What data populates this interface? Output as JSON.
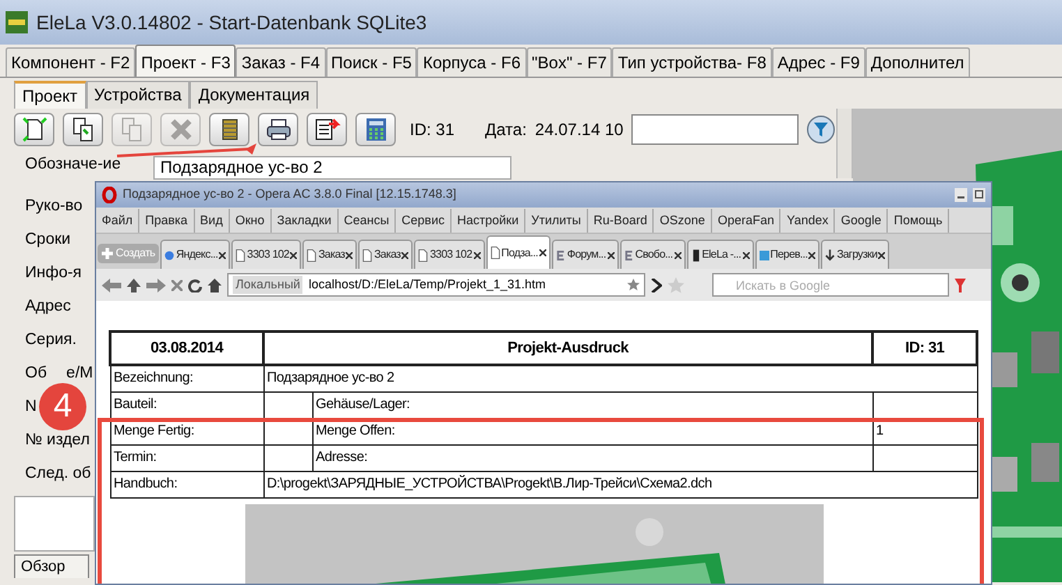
{
  "window": {
    "title": "EleLa V3.0.14802  - Start-Datenbank SQLite3"
  },
  "main_tabs": [
    {
      "label": "Компонент - F2",
      "selected": false
    },
    {
      "label": "Проект - F3",
      "selected": true
    },
    {
      "label": "Заказ - F4",
      "selected": false
    },
    {
      "label": "Поиск - F5",
      "selected": false
    },
    {
      "label": "Корпуса - F6",
      "selected": false
    },
    {
      "label": "\"Box\" - F7",
      "selected": false
    },
    {
      "label": "Тип устройства- F8",
      "selected": false
    },
    {
      "label": "Адрес - F9",
      "selected": false
    },
    {
      "label": "Дополнител",
      "selected": false
    }
  ],
  "sub_tabs": [
    {
      "label": "Проект",
      "selected": true
    },
    {
      "label": "Устройства",
      "selected": false
    },
    {
      "label": "Документация",
      "selected": false
    }
  ],
  "toolbar": {
    "buttons": [
      {
        "kind": "new",
        "disabled": false
      },
      {
        "kind": "copy",
        "disabled": false
      },
      {
        "kind": "duplicate",
        "disabled": true
      },
      {
        "kind": "delete",
        "disabled": true
      },
      {
        "kind": "spool",
        "disabled": false
      },
      {
        "kind": "print",
        "disabled": false
      },
      {
        "kind": "export",
        "disabled": false
      },
      {
        "kind": "calculator",
        "disabled": false
      }
    ],
    "id_label": "ID: 31",
    "date_label": "Дата:",
    "date_value": "24.07.14 10"
  },
  "form": {
    "field_value": "Подзарядное ус-во 2",
    "labels": [
      {
        "parts": [
          "Обозначе-ие"
        ]
      },
      {
        "parts": [
          "Руко-во"
        ]
      },
      {
        "parts": [
          "Сроки"
        ]
      },
      {
        "parts": [
          "Инфо-я"
        ]
      },
      {
        "parts": [
          "Адрес"
        ]
      },
      {
        "parts": [
          "Серия."
        ]
      },
      {
        "parts": [
          "Об",
          "е/М"
        ]
      },
      {
        "parts": [
          "N"
        ]
      },
      {
        "parts": [
          "№ издел"
        ]
      },
      {
        "parts": [
          "След. об"
        ]
      }
    ],
    "bottom_tab": "Обзор"
  },
  "browser": {
    "title": "Подзарядное ус-во 2 - Opera AC 3.8.0 Final [12.15.1748.3]",
    "menu": [
      "Файл",
      "Правка",
      "Вид",
      "Окно",
      "Закладки",
      "Сеансы",
      "Сервис",
      "Настройки",
      "Утилиты",
      "Ru-Board",
      "OSzone",
      "OperaFan",
      "Yandex",
      "Google",
      "Помощь"
    ],
    "new_tab": "Создать",
    "tabs": [
      {
        "label": "Яндекс...",
        "selected": false,
        "kind": "yandex"
      },
      {
        "label": "3303 102",
        "selected": false,
        "kind": "page"
      },
      {
        "label": "Заказ",
        "selected": false,
        "kind": "page"
      },
      {
        "label": "Заказ",
        "selected": false,
        "kind": "page"
      },
      {
        "label": "3303 102",
        "selected": false,
        "kind": "page"
      },
      {
        "label": "Подза...",
        "selected": true,
        "kind": "page"
      },
      {
        "label": "Форум...",
        "selected": false,
        "kind": "forum"
      },
      {
        "label": "Свобо...",
        "selected": false,
        "kind": "forum"
      },
      {
        "label": "EleLa -...",
        "selected": false,
        "kind": "app"
      },
      {
        "label": "Перев...",
        "selected": false,
        "kind": "translate"
      },
      {
        "label": "Загрузки",
        "selected": false,
        "kind": "download"
      }
    ],
    "address_prefix": "Локальный",
    "address": "localhost/D:/EleLa/Temp/Projekt_1_31.htm",
    "search_placeholder": "Искать в Google",
    "report": {
      "header": [
        "03.08.2014",
        "Projekt-Ausdruck",
        "ID: 31"
      ],
      "rows": [
        {
          "kind": "wide",
          "label": "Bezeichnung:",
          "value": "Подзарядное ус-во 2"
        },
        {
          "kind": "split",
          "label": "Bauteil:",
          "label2": "Gehäuse/Lager:"
        },
        {
          "kind": "split",
          "label": "Menge Fertig:",
          "label2": "Menge Offen:",
          "value2": "1"
        },
        {
          "kind": "split",
          "label": "Termin:",
          "label2": "Adresse:"
        },
        {
          "kind": "wide",
          "label": "Handbuch:",
          "value": "D:\\progekt\\ЗАРЯДНЫЕ_УСТРОЙСТВА\\Progekt\\В.Лир-Трейси\\Схема2.dch"
        }
      ]
    }
  },
  "callout": {
    "number": "4"
  }
}
